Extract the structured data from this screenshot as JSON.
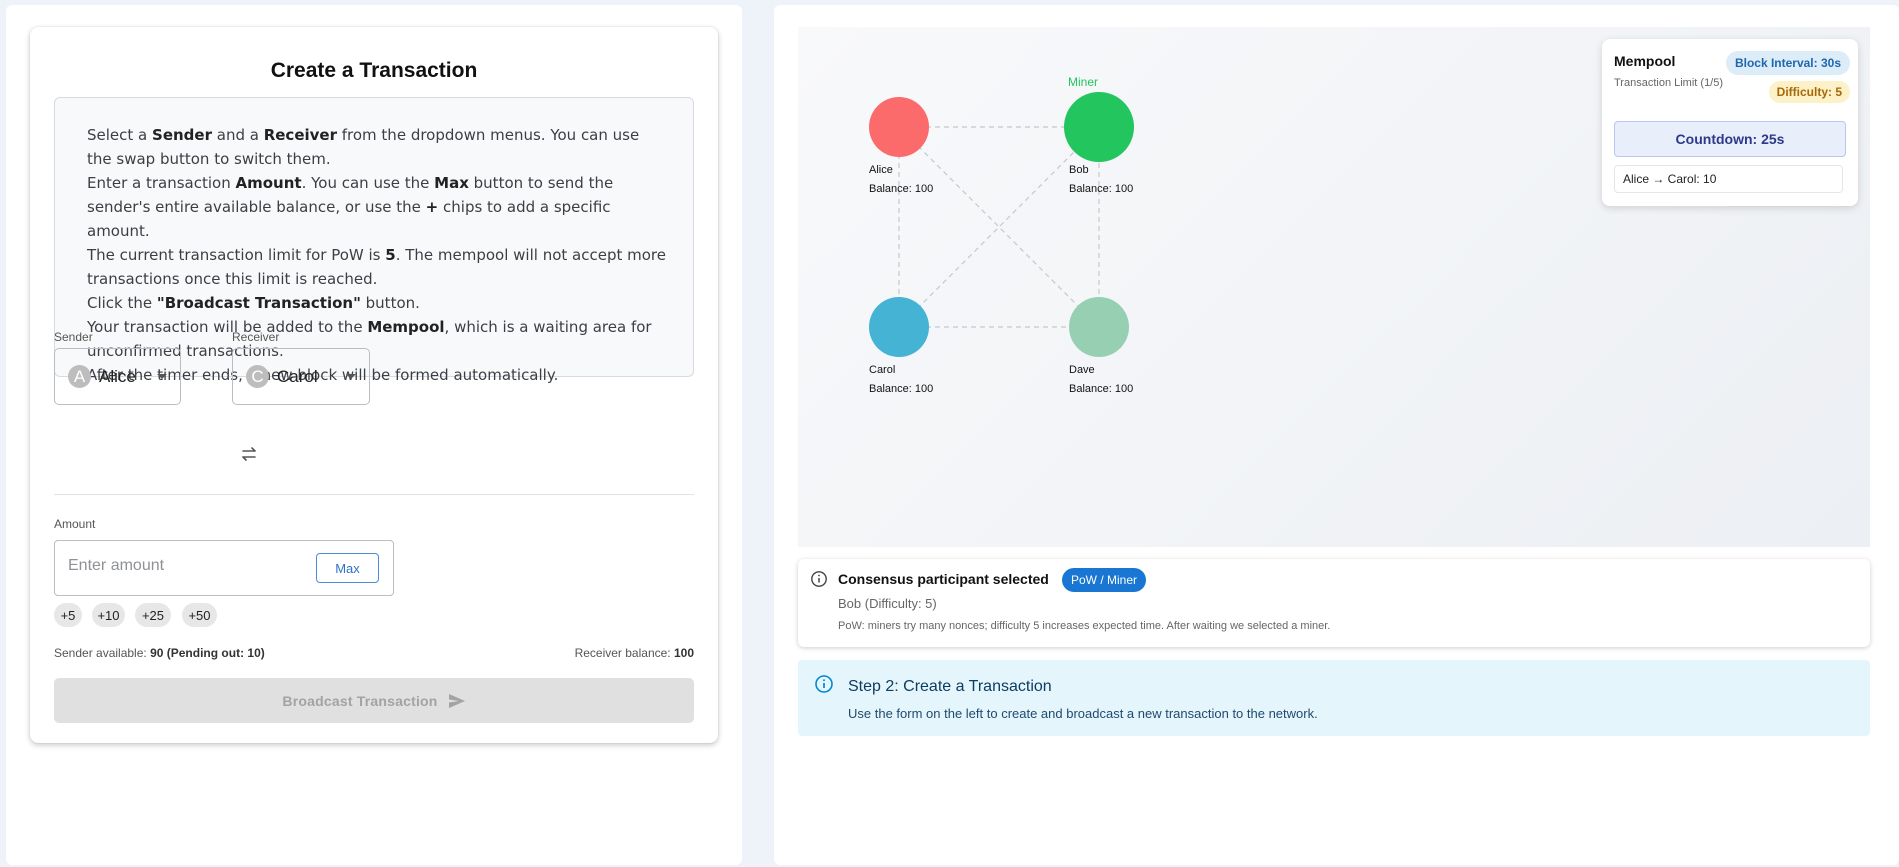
{
  "create_tx": {
    "title": "Create a Transaction",
    "instructions": [
      [
        {
          "t": "Select a "
        },
        {
          "b": "Sender"
        },
        {
          "t": " and a "
        },
        {
          "b": "Receiver"
        },
        {
          "t": " from the dropdown menus. You can use the swap button to switch them."
        }
      ],
      [
        {
          "t": "Enter a transaction "
        },
        {
          "b": "Amount"
        },
        {
          "t": ". You can use the "
        },
        {
          "b": "Max"
        },
        {
          "t": " button to send the sender's entire available balance, or use the "
        },
        {
          "b": "+"
        },
        {
          "t": " chips to add a specific amount."
        }
      ],
      [
        {
          "t": "The current transaction limit for PoW is "
        },
        {
          "b": "5"
        },
        {
          "t": ". The mempool will not accept more transactions once this limit is reached."
        }
      ],
      [
        {
          "t": "Click the "
        },
        {
          "b": "\"Broadcast Transaction\""
        },
        {
          "t": " button."
        }
      ],
      [
        {
          "t": "Your transaction will be added to the "
        },
        {
          "b": "Mempool"
        },
        {
          "t": ", which is a waiting area for unconfirmed transactions."
        }
      ],
      [
        {
          "t": "After the timer ends, a new block will be formed automatically."
        }
      ]
    ],
    "sender": {
      "label": "Sender",
      "initial": "A",
      "value": "Alice"
    },
    "receiver": {
      "label": "Receiver",
      "initial": "C",
      "value": "Carol"
    },
    "amount": {
      "label": "Amount",
      "placeholder": "Enter amount",
      "max_label": "Max"
    },
    "chips": [
      "+5",
      "+10",
      "+25",
      "+50"
    ],
    "sender_available_label": "Sender available: ",
    "sender_available_value": "90 (Pending out: 10)",
    "receiver_balance_label": "Receiver balance: ",
    "receiver_balance_value": "100",
    "broadcast_label": "Broadcast Transaction"
  },
  "network": {
    "miner_label": "Miner",
    "nodes": [
      {
        "name": "Alice",
        "balance": "Balance: 100",
        "color": "#fb6b6b"
      },
      {
        "name": "Bob",
        "balance": "Balance: 100",
        "color": "#22c55e"
      },
      {
        "name": "Carol",
        "balance": "Balance: 100",
        "color": "#45b3d3"
      },
      {
        "name": "Dave",
        "balance": "Balance: 100",
        "color": "#96cfb1"
      }
    ]
  },
  "mempool": {
    "title": "Mempool",
    "limit_label": "Transaction Limit (1/5)",
    "block_interval": "Block Interval: 30s",
    "difficulty": "Difficulty: 5",
    "countdown": "Countdown: 25s",
    "transactions": [
      "Alice → Carol: 10"
    ]
  },
  "consensus": {
    "title": "Consensus participant selected",
    "badge": "PoW / Miner",
    "selected": "Bob (Difficulty: 5)",
    "note": "PoW: miners try many nonces; difficulty 5 increases expected time. After waiting we selected a miner."
  },
  "step": {
    "title": "Step 2: Create a Transaction",
    "text": "Use the form on the left to create and broadcast a new transaction to the network."
  },
  "colors": {
    "primary": "#1976d2",
    "miner": "#22c55e",
    "info_bg": "#e5f5fc"
  }
}
